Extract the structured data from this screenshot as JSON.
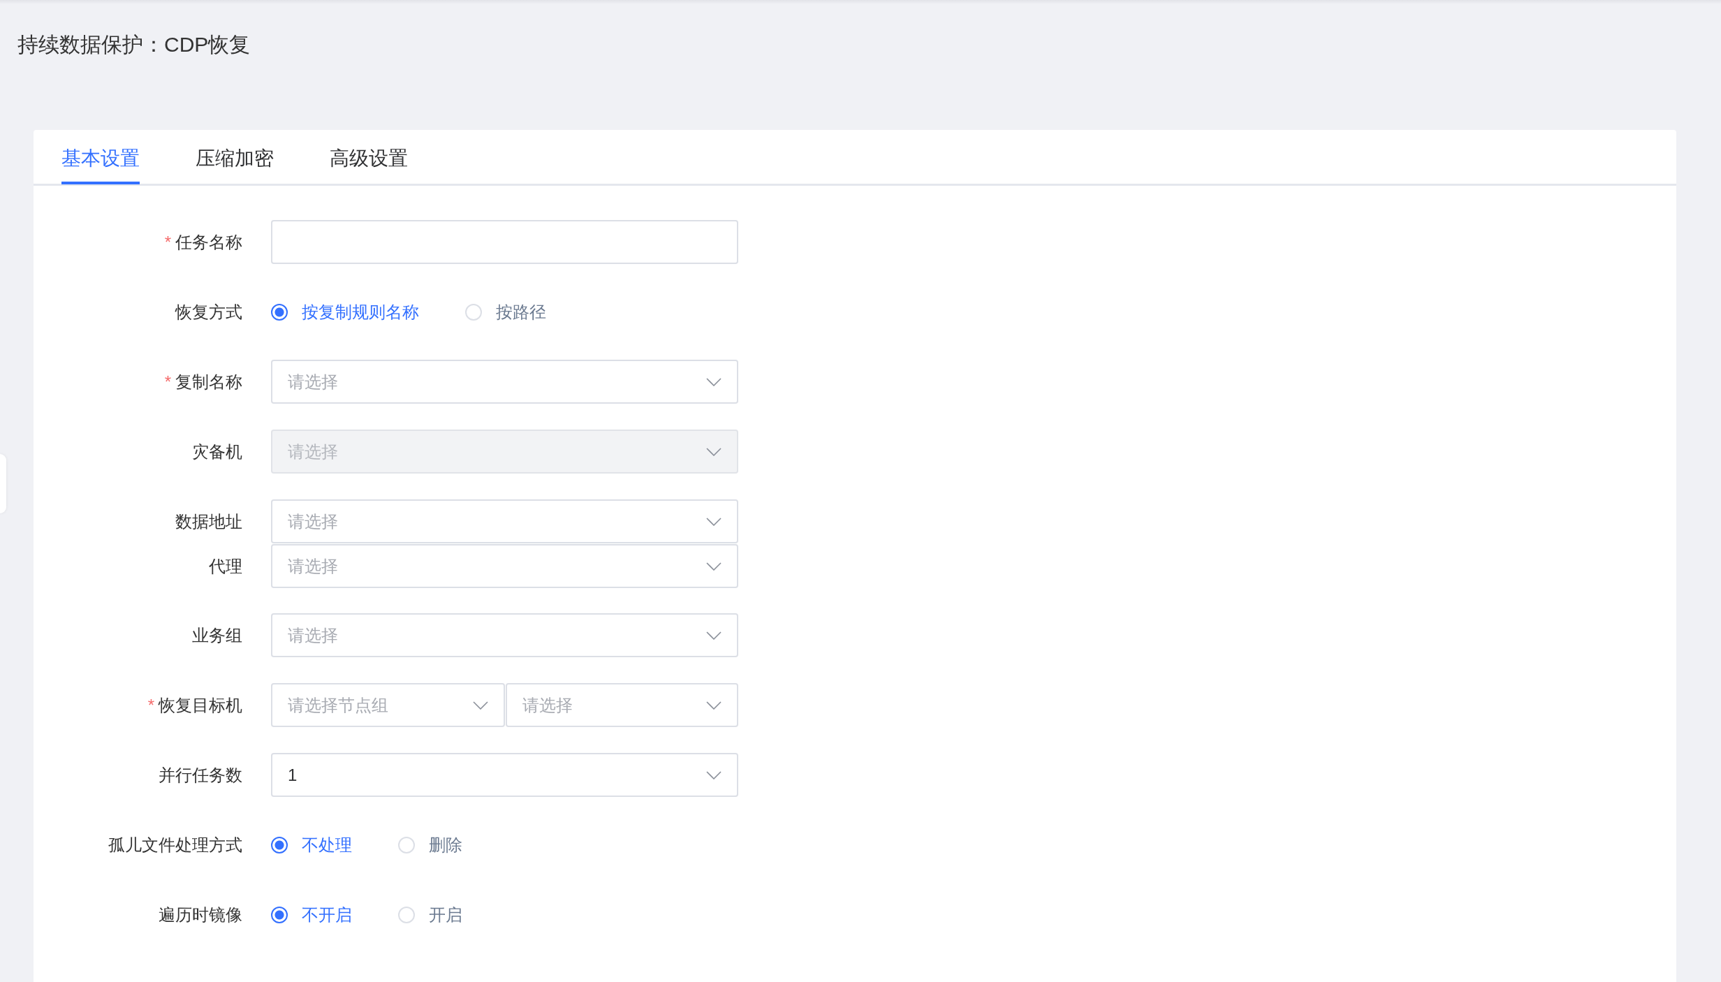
{
  "page_title": "持续数据保护：CDP恢复",
  "tabs": [
    {
      "label": "基本设置",
      "selected": true
    },
    {
      "label": "压缩加密",
      "selected": false
    },
    {
      "label": "高级设置",
      "selected": false
    }
  ],
  "form": {
    "fields": [
      {
        "kind": "input",
        "label": "任务名称",
        "required_mark": "*"
      },
      {
        "kind": "radio",
        "label": "恢复方式",
        "options": [
          {
            "label": "按复制规则名称",
            "selected": true
          },
          {
            "label": "按路径",
            "selected": false
          }
        ]
      },
      {
        "kind": "select",
        "label": "复制名称",
        "required_mark": "*",
        "placeholder": "请选择",
        "disabled": false
      },
      {
        "kind": "select",
        "label": "灾备机",
        "placeholder": "请选择",
        "disabled": true
      },
      {
        "kind": "group",
        "fields": [
          {
            "kind": "select",
            "label": "数据地址",
            "placeholder": "请选择",
            "disabled": false
          },
          {
            "kind": "select",
            "label": "代理",
            "placeholder": "请选择",
            "disabled": false
          }
        ]
      },
      {
        "kind": "select",
        "label": "业务组",
        "placeholder": "请选择",
        "disabled": false
      },
      {
        "kind": "dual-select",
        "label": "恢复目标机",
        "required_mark": "*",
        "selects": [
          {
            "placeholder": "请选择节点组",
            "disabled": false
          },
          {
            "placeholder": "请选择",
            "disabled": false
          }
        ]
      },
      {
        "kind": "select",
        "label": "并行任务数",
        "value": "1",
        "disabled": false
      },
      {
        "kind": "radio",
        "label": "孤儿文件处理方式",
        "options": [
          {
            "label": "不处理",
            "selected": true
          },
          {
            "label": "删除",
            "selected": false
          }
        ]
      },
      {
        "kind": "radio",
        "label": "遍历时镜像",
        "options": [
          {
            "label": "不开启",
            "selected": true
          },
          {
            "label": "开启",
            "selected": false
          }
        ]
      }
    ]
  }
}
